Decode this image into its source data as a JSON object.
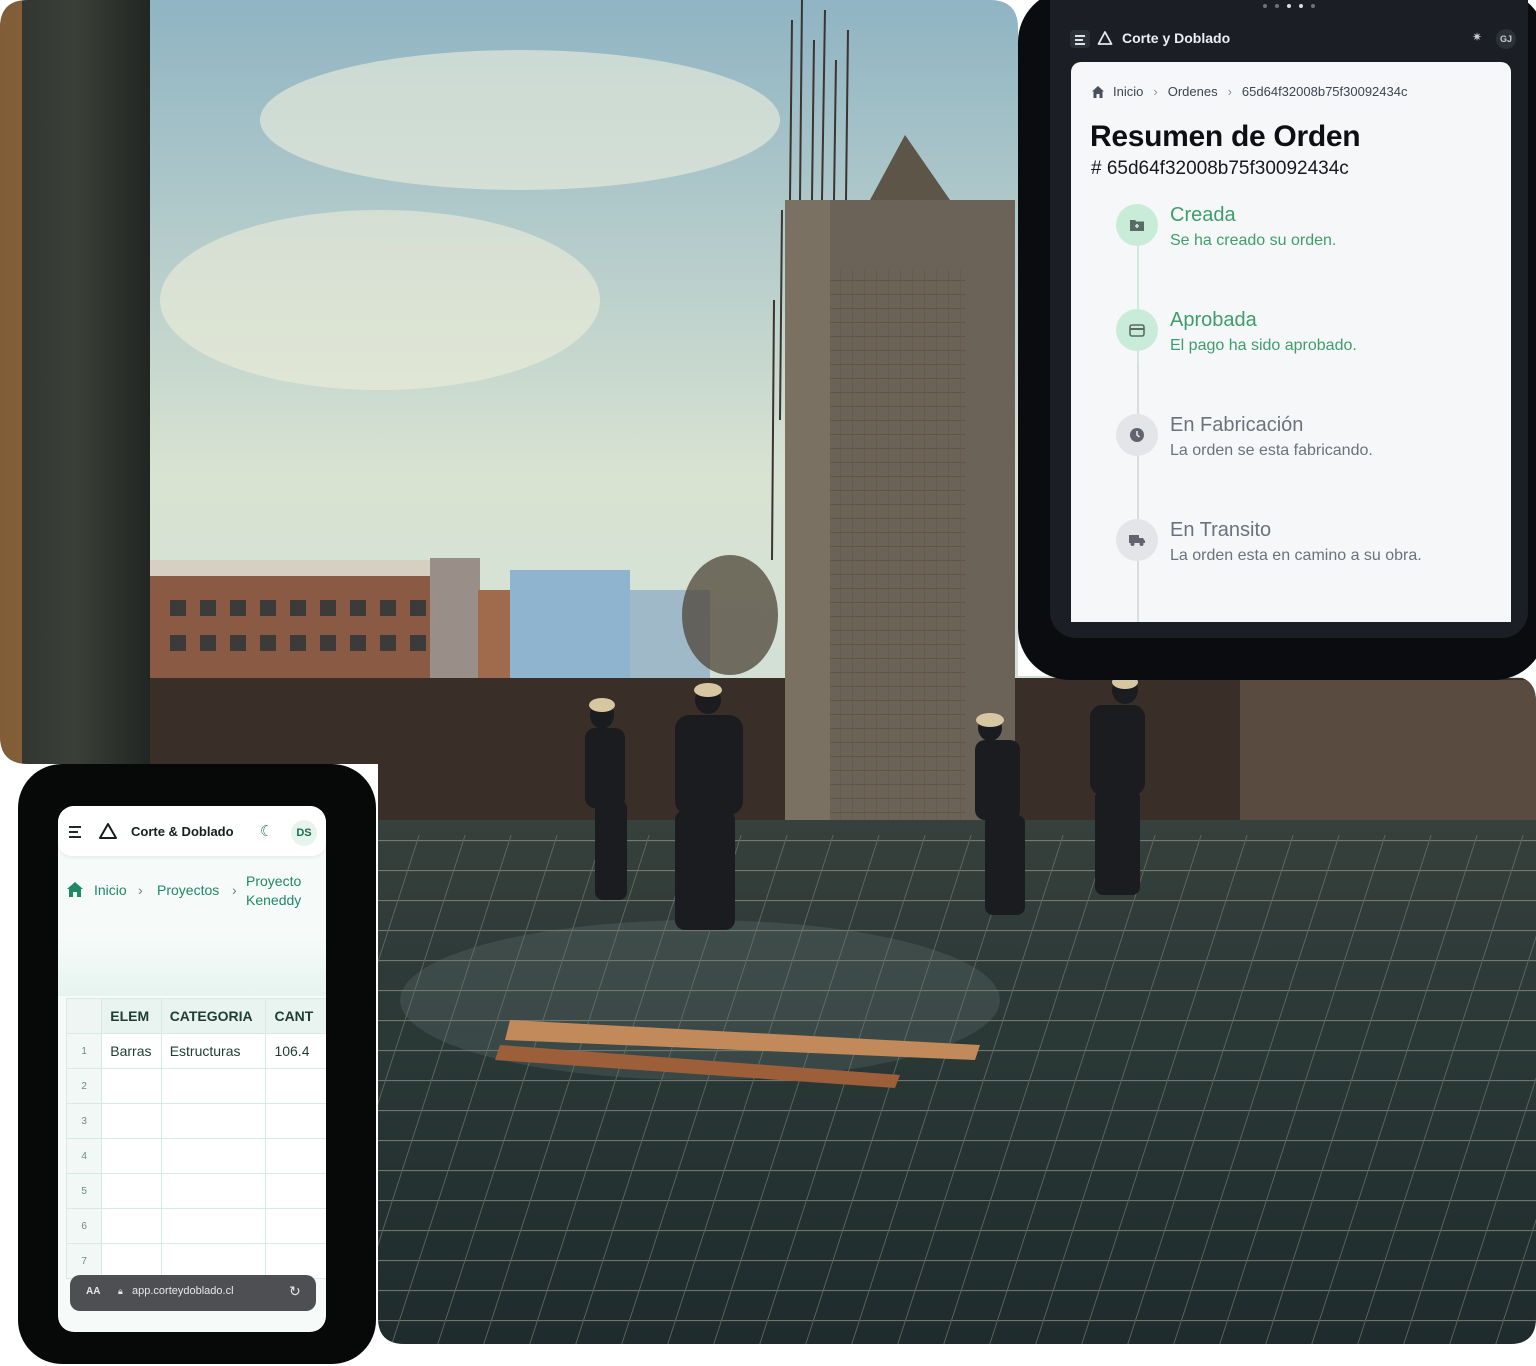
{
  "tablet": {
    "app_title": "Corte y Doblado",
    "avatar": "GJ",
    "icons": [
      "menu-icon",
      "warning-triangle-logo-icon",
      "sun-icon"
    ],
    "breadcrumb": {
      "home": "Inicio",
      "orders": "Ordenes",
      "current": "65d64f32008b75f30092434c"
    },
    "title": "Resumen de Orden",
    "order_id": "# 65d64f32008b75f30092434c",
    "steps": [
      {
        "title": "Creada",
        "desc": "Se ha creado su orden.",
        "status": "done",
        "icon": "folder-plus-icon"
      },
      {
        "title": "Aprobada",
        "desc": "El pago ha sido aprobado.",
        "status": "done",
        "icon": "credit-card-icon"
      },
      {
        "title": "En Fabricación",
        "desc": "La orden se esta fabricando.",
        "status": "pending",
        "icon": "clock-icon"
      },
      {
        "title": "En Transito",
        "desc": "La orden esta en camino a su obra.",
        "status": "pending",
        "icon": "truck-icon"
      }
    ],
    "colors": {
      "done": "#3d9e6b",
      "pending": "#6c717c"
    }
  },
  "phone": {
    "app_title": "Corte & Doblado",
    "avatar": "DS",
    "icons": [
      "menu-icon",
      "warning-triangle-logo-icon",
      "moon-icon"
    ],
    "breadcrumb": {
      "home": "Inicio",
      "projects": "Proyectos",
      "current": "Proyecto Keneddy"
    },
    "table": {
      "columns": [
        "ELEM",
        "CATEGORIA",
        "CANT"
      ],
      "rows": [
        {
          "n": "1",
          "cells": [
            "Barras",
            "Estructuras",
            "106.4"
          ]
        },
        {
          "n": "2",
          "cells": [
            "",
            "",
            ""
          ]
        },
        {
          "n": "3",
          "cells": [
            "",
            "",
            ""
          ]
        },
        {
          "n": "4",
          "cells": [
            "",
            "",
            ""
          ]
        },
        {
          "n": "5",
          "cells": [
            "",
            "",
            ""
          ]
        },
        {
          "n": "6",
          "cells": [
            "",
            "",
            ""
          ]
        },
        {
          "n": "7",
          "cells": [
            "",
            "",
            ""
          ]
        }
      ]
    },
    "browser": {
      "text_size": "AA",
      "url": "app.corteydoblado.cl"
    },
    "accent": "#1d8a63"
  }
}
